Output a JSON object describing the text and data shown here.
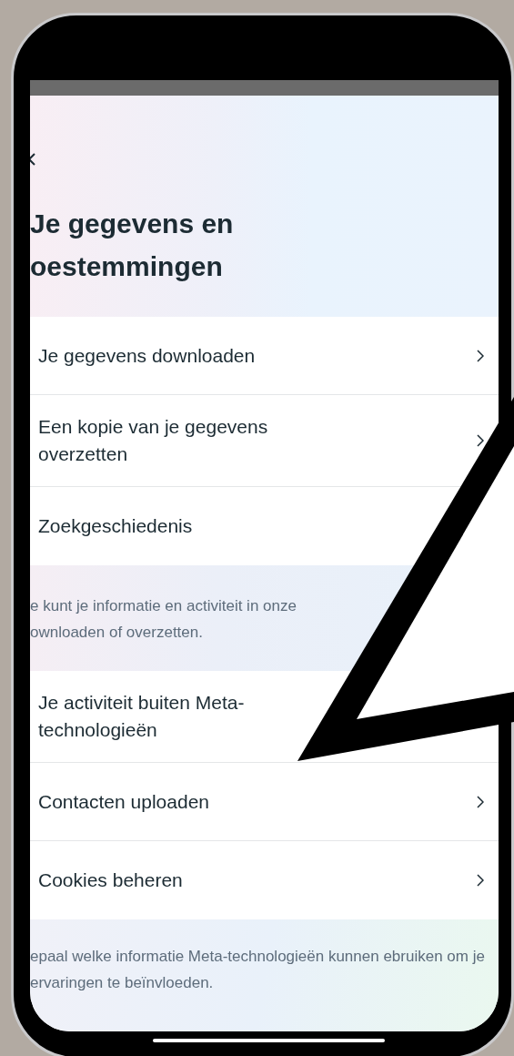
{
  "header": {
    "title": "Je gegevens en oestemmingen"
  },
  "sections": [
    {
      "items": [
        {
          "label": "Je gegevens downloaden",
          "chevron": true
        },
        {
          "label": "Een kopie van je gegevens overzetten",
          "chevron": true
        },
        {
          "label": "Zoekgeschiedenis",
          "chevron": false
        }
      ],
      "caption": "e kunt je informatie en activiteit in onze ownloaden of overzetten."
    },
    {
      "items": [
        {
          "label": "Je activiteit buiten Meta-technologieën",
          "chevron": false
        },
        {
          "label": "Contacten uploaden",
          "chevron": true
        },
        {
          "label": "Cookies beheren",
          "chevron": true
        }
      ],
      "caption": "epaal welke informatie Meta-technologieën kunnen ebruiken om je ervaringen te beïnvloeden."
    }
  ]
}
